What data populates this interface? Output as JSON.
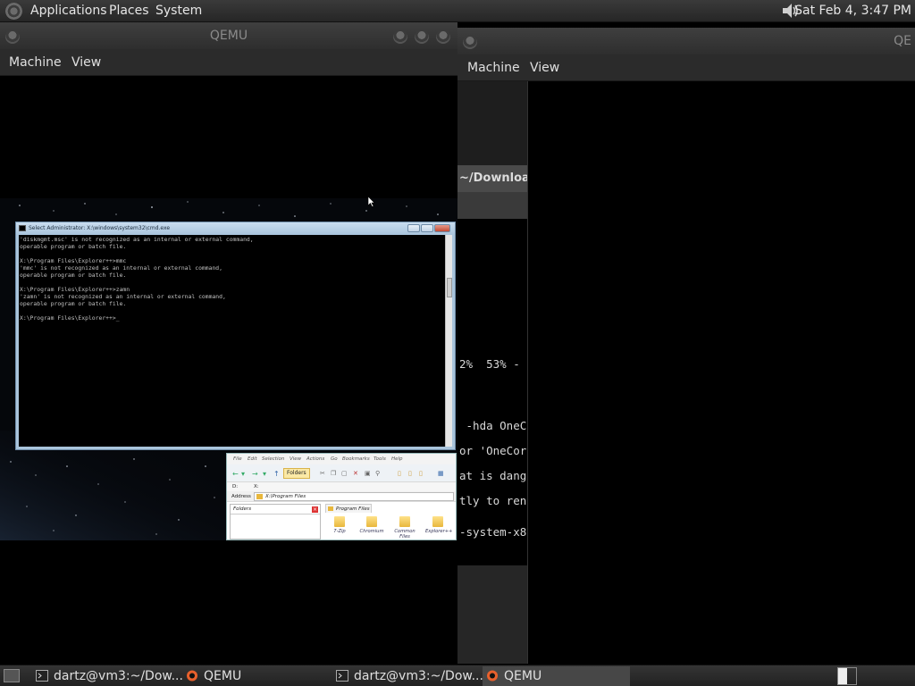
{
  "top_panel": {
    "menus": [
      "Applications",
      "Places",
      "System"
    ],
    "clock": "Sat Feb  4,  3:47 PM"
  },
  "qemu_left": {
    "title": "QEMU",
    "menu": [
      "Machine",
      "View"
    ]
  },
  "qemu_right": {
    "title": "QE",
    "menu": [
      "Machine",
      "View"
    ]
  },
  "cmd_window": {
    "title": "Select Administrator: X:\\windows\\system32\\cmd.exe",
    "lines": "'diskmgmt.msc' is not recognized as an internal or external command,\noperable program or batch file.\n\nX:\\Program Files\\Explorer++>mmc\n'mmc' is not recognized as an internal or external command,\noperable program or batch file.\n\nX:\\Program Files\\Explorer++>zamn\n'zamn' is not recognized as an internal or external command,\noperable program or batch file.\n\nX:\\Program Files\\Explorer++>_"
  },
  "explorer": {
    "menu": [
      "File",
      "Edit",
      "Selection",
      "View",
      "Actions",
      "Go",
      "Bookmarks",
      "Tools",
      "Help"
    ],
    "folders_button": "Folders",
    "drives": [
      "D:",
      "X:"
    ],
    "address_label": "Address",
    "address_value": "X:\\Program Files",
    "folders_pane_label": "Folders",
    "tab_label": "Program Files",
    "items": [
      "7-Zip",
      "Chromium",
      "Common Files",
      "Explorer++"
    ]
  },
  "right_window_text": {
    "downloads": "~/Download",
    "progress": "2%  53% -",
    "hda": " -hda OneC",
    "onecor": "or 'OneCor",
    "danger": "at is dang",
    "rem": "tly to ren",
    "system": "-system-x8"
  },
  "taskbar": {
    "items": [
      {
        "label": "dartz@vm3:~/Dow...",
        "icon": "terminal-icon",
        "active": false
      },
      {
        "label": "QEMU",
        "icon": "qemu-icon",
        "active": false
      },
      {
        "label": "dartz@vm3:~/Dow...",
        "icon": "terminal-icon",
        "active": false
      },
      {
        "label": "QEMU",
        "icon": "qemu-icon",
        "active": true
      }
    ]
  }
}
